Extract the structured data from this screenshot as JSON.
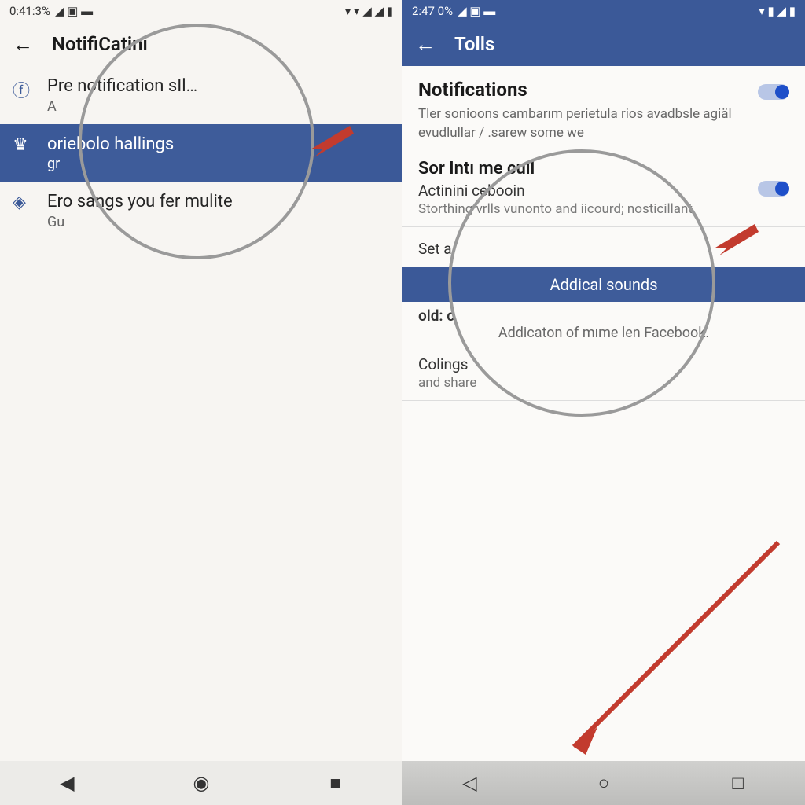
{
  "left": {
    "status": {
      "time": "0:41:3%",
      "icons": "◢ ▣ ▬",
      "right_icons": "▾ ▾ ◢ ◢ ▮"
    },
    "appbar": {
      "title": "NotifiCatini"
    },
    "items": [
      {
        "icon": "f",
        "primary": "Pre notification sIl…",
        "secondary": "A"
      },
      {
        "icon": "♛",
        "primary": "oriebolo hallings",
        "secondary": "gr"
      },
      {
        "icon": "◈",
        "primary": "Ero sangs you fer mulite",
        "secondary": "Gu"
      }
    ],
    "nav": {
      "back": "◀",
      "home": "◉",
      "recent": "■"
    }
  },
  "right": {
    "status": {
      "time": "2:47 0%",
      "icons": "◢ ▣ ▬",
      "right_icons": "▾ ▮ ◢ ▮"
    },
    "appbar": {
      "title": "Tolls"
    },
    "sections": {
      "notifications": {
        "title": "Notifications",
        "desc": "Tler sonioons cambarım perietula rios avadbsle agiäl evudlullar / .sarew some we"
      },
      "sor": {
        "title": "Sor Intı me cull",
        "sub": "Actinini cebooin",
        "desc": "Storthing vrlls vunonto and iicourd; nosticillant"
      },
      "highlight": {
        "label": "Addical sounds",
        "after": "Addicaton of mıme len Facebook."
      },
      "set": {
        "line1": "Set a",
        "line2": "old: c"
      },
      "col": {
        "line1": "Colings",
        "line2": "and share"
      }
    },
    "nav": {
      "back": "◁",
      "home": "○",
      "recent": "□"
    }
  }
}
